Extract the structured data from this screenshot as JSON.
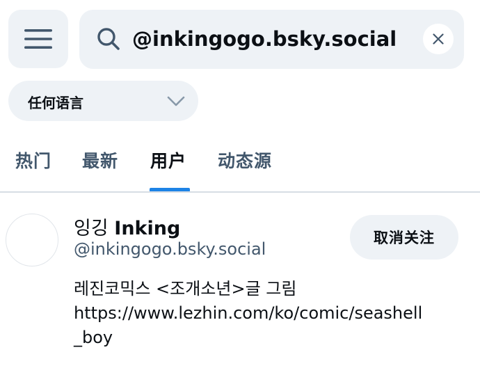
{
  "search": {
    "query": "@inkingogo.bsky.social"
  },
  "language_filter": {
    "selected": "任何语言"
  },
  "tabs": [
    {
      "label": "热门",
      "active": false
    },
    {
      "label": "最新",
      "active": false
    },
    {
      "label": "用户",
      "active": true
    },
    {
      "label": "动态源",
      "active": false
    }
  ],
  "profile": {
    "name_korean": "잉깅",
    "name_latin": "Inking",
    "handle": "@inkingogo.bsky.social",
    "follow_button_label": "取消关注",
    "bio_lines": [
      "레진코믹스 <조개소년>글 그림",
      "https://www.lezhin.com/ko/comic/seashell",
      "_boy"
    ]
  },
  "colors": {
    "accent": "#1d83e6",
    "surface": "#eef2f6",
    "muted_text": "#42576c"
  },
  "icons": [
    "menu-icon",
    "search-icon",
    "close-icon",
    "chevron-down-icon"
  ]
}
